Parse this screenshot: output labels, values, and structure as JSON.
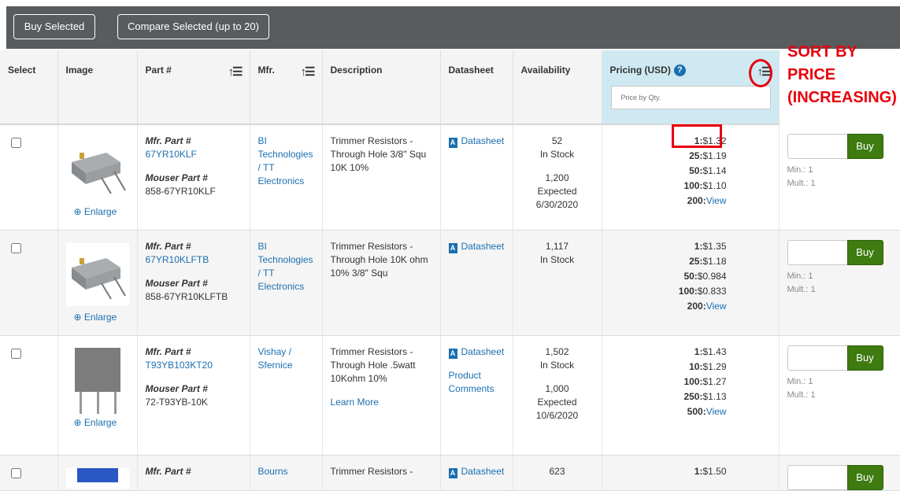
{
  "toolbar": {
    "buy_selected_label": "Buy Selected",
    "compare_selected_label": "Compare Selected (up to 20)"
  },
  "columns": {
    "select": "Select",
    "image": "Image",
    "part": "Part #",
    "mfr": "Mfr.",
    "description": "Description",
    "datasheet": "Datasheet",
    "availability": "Availability",
    "pricing": "Pricing (USD)",
    "price_placeholder": "Price by Qty."
  },
  "icons": {
    "sort": "sort-ascending-icon",
    "help": "question-circle-icon",
    "pdf": "pdf-icon",
    "zoom": "magnify-icon",
    "checkbox": "checkbox"
  },
  "annotation": {
    "line1": "SORT BY",
    "line2": "PRICE",
    "line3": "(INCREASING)",
    "color": "#e8000b"
  },
  "colors": {
    "toolbar_bg": "#595c5f",
    "pricing_header_bg": "#cfe9f2",
    "link": "#1a6fb0",
    "buy_button": "#3e7b10"
  },
  "labels": {
    "mfr_part": "Mfr. Part #",
    "mouser_part": "Mouser Part #",
    "enlarge": "Enlarge",
    "datasheet": "Datasheet",
    "buy": "Buy",
    "min": "Min.: 1",
    "mult": "Mult.: 1",
    "view": "View"
  },
  "rows": [
    {
      "mfr_part": "67YR10KLF",
      "mouser_part": "858-67YR10KLF",
      "mfr": [
        "BI",
        "Technologies",
        "/ TT",
        "Electronics"
      ],
      "description": [
        "Trimmer Resistors -",
        "Through Hole 3/8\" Squ",
        "10K 10%"
      ],
      "extra_links": [],
      "availability": [
        "52",
        "In Stock",
        "",
        "1,200",
        "Expected",
        "6/30/2020"
      ],
      "prices": [
        {
          "qty": "1:",
          "price": "$1.32"
        },
        {
          "qty": "25:",
          "price": "$1.19"
        },
        {
          "qty": "50:",
          "price": "$1.14"
        },
        {
          "qty": "100:",
          "price": "$1.10"
        },
        {
          "qty": "200:",
          "price": "View"
        }
      ]
    },
    {
      "mfr_part": "67YR10KLFTB",
      "mouser_part": "858-67YR10KLFTB",
      "mfr": [
        "BI",
        "Technologies",
        "/ TT",
        "Electronics"
      ],
      "description": [
        "Trimmer Resistors -",
        "Through Hole 10K ohm",
        "10% 3/8\" Squ"
      ],
      "extra_links": [],
      "availability": [
        "1,117",
        "In Stock"
      ],
      "prices": [
        {
          "qty": "1:",
          "price": "$1.35"
        },
        {
          "qty": "25:",
          "price": "$1.18"
        },
        {
          "qty": "50:",
          "price": "$0.984"
        },
        {
          "qty": "100:",
          "price": "$0.833"
        },
        {
          "qty": "200:",
          "price": "View"
        }
      ]
    },
    {
      "mfr_part": "T93YB103KT20",
      "mouser_part": "72-T93YB-10K",
      "mfr": [
        "Vishay /",
        "Sfernice"
      ],
      "description": [
        "Trimmer Resistors -",
        "Through Hole .5watt",
        "10Kohm 10%"
      ],
      "learn_more": "Learn More",
      "extra_links": [
        "Product",
        "Comments"
      ],
      "availability": [
        "1,502",
        "In Stock",
        "",
        "1,000",
        "Expected",
        "10/6/2020"
      ],
      "prices": [
        {
          "qty": "1:",
          "price": "$1.43"
        },
        {
          "qty": "10:",
          "price": "$1.29"
        },
        {
          "qty": "100:",
          "price": "$1.27"
        },
        {
          "qty": "250:",
          "price": "$1.13"
        },
        {
          "qty": "500:",
          "price": "View"
        }
      ]
    },
    {
      "mfr_part": "",
      "mouser_part": "",
      "mfr": [
        "Bourns"
      ],
      "description": [
        "Trimmer Resistors -"
      ],
      "extra_links": [],
      "availability": [
        "623"
      ],
      "prices": [
        {
          "qty": "1:",
          "price": "$1.50"
        }
      ]
    }
  ]
}
